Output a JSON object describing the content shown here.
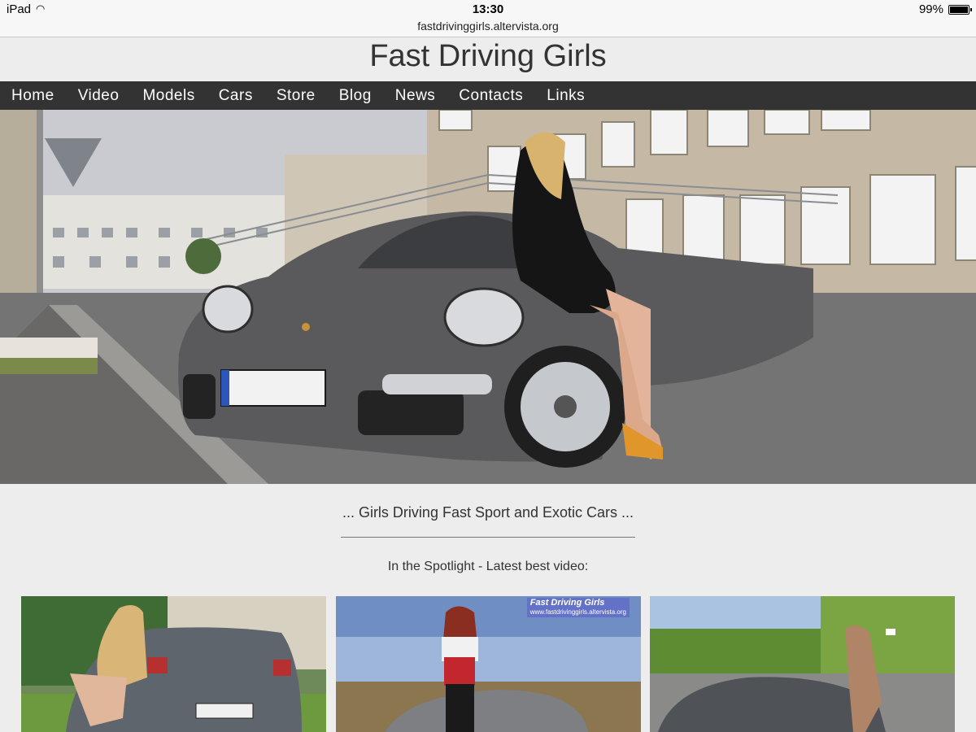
{
  "status_bar": {
    "device": "iPad",
    "time": "13:30",
    "battery": "99%"
  },
  "browser": {
    "url": "fastdrivinggirls.altervista.org"
  },
  "site": {
    "title": "Fast Driving Girls"
  },
  "nav": {
    "items": [
      {
        "label": "Home"
      },
      {
        "label": "Video"
      },
      {
        "label": "Models"
      },
      {
        "label": "Cars"
      },
      {
        "label": "Store"
      },
      {
        "label": "Blog"
      },
      {
        "label": "News"
      },
      {
        "label": "Contacts"
      },
      {
        "label": "Links"
      }
    ]
  },
  "main": {
    "tagline": "... Girls Driving Fast Sport and Exotic Cars ...",
    "spotlight": "In the Spotlight - Latest best video:",
    "watermark_title": "Fast Driving Girls",
    "watermark_url": "www.fastdrivinggirls.altervista.org"
  },
  "colors": {
    "nav_bg": "#333333",
    "page_bg": "#ededed",
    "car_grey": "#5c5c5e"
  }
}
